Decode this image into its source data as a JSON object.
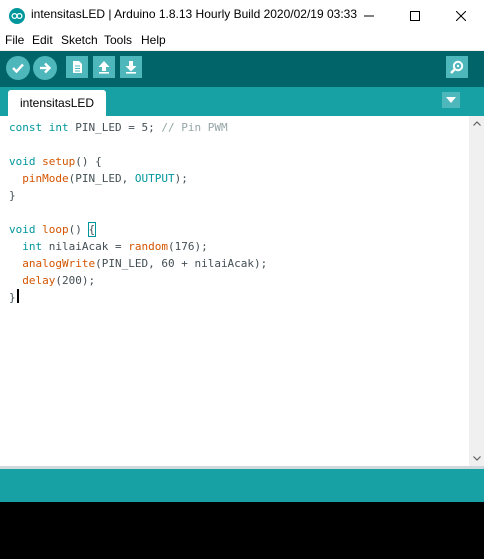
{
  "window": {
    "title": "intensitasLED | Arduino 1.8.13 Hourly Build 2020/02/19 03:33",
    "minimize_icon": "minimize-icon",
    "maximize_icon": "maximize-icon",
    "close_icon": "close-icon"
  },
  "menu": {
    "items": [
      "File",
      "Edit",
      "Sketch",
      "Tools",
      "Help"
    ]
  },
  "toolbar": {
    "buttons": [
      {
        "name": "verify",
        "icon": "checkmark-icon"
      },
      {
        "name": "upload",
        "icon": "arrow-right-icon"
      },
      {
        "name": "new",
        "icon": "document-icon"
      },
      {
        "name": "open",
        "icon": "arrow-up-icon"
      },
      {
        "name": "save",
        "icon": "arrow-down-icon"
      },
      {
        "name": "serial-monitor",
        "icon": "magnifier-icon"
      }
    ]
  },
  "tabs": {
    "active": "intensitasLED",
    "menu_icon": "triangle-down-icon"
  },
  "editor": {
    "lines": [
      "const int PIN_LED = 5; // Pin PWM",
      "",
      "void setup() {",
      "  pinMode(PIN_LED, OUTPUT);",
      "}",
      "",
      "void loop() {",
      "  int nilaiAcak = random(176);",
      "  analogWrite(PIN_LED, 60 + nilaiAcak);",
      "  delay(200);",
      "}"
    ]
  },
  "colors": {
    "toolbar_bg": "#006468",
    "tab_bar_bg": "#17a1a5",
    "button_bg": "#4db7bb",
    "keyword_color": "#00979c",
    "function_color": "#d35400",
    "comment_color": "#95a5a6",
    "console_bg": "#000000"
  }
}
